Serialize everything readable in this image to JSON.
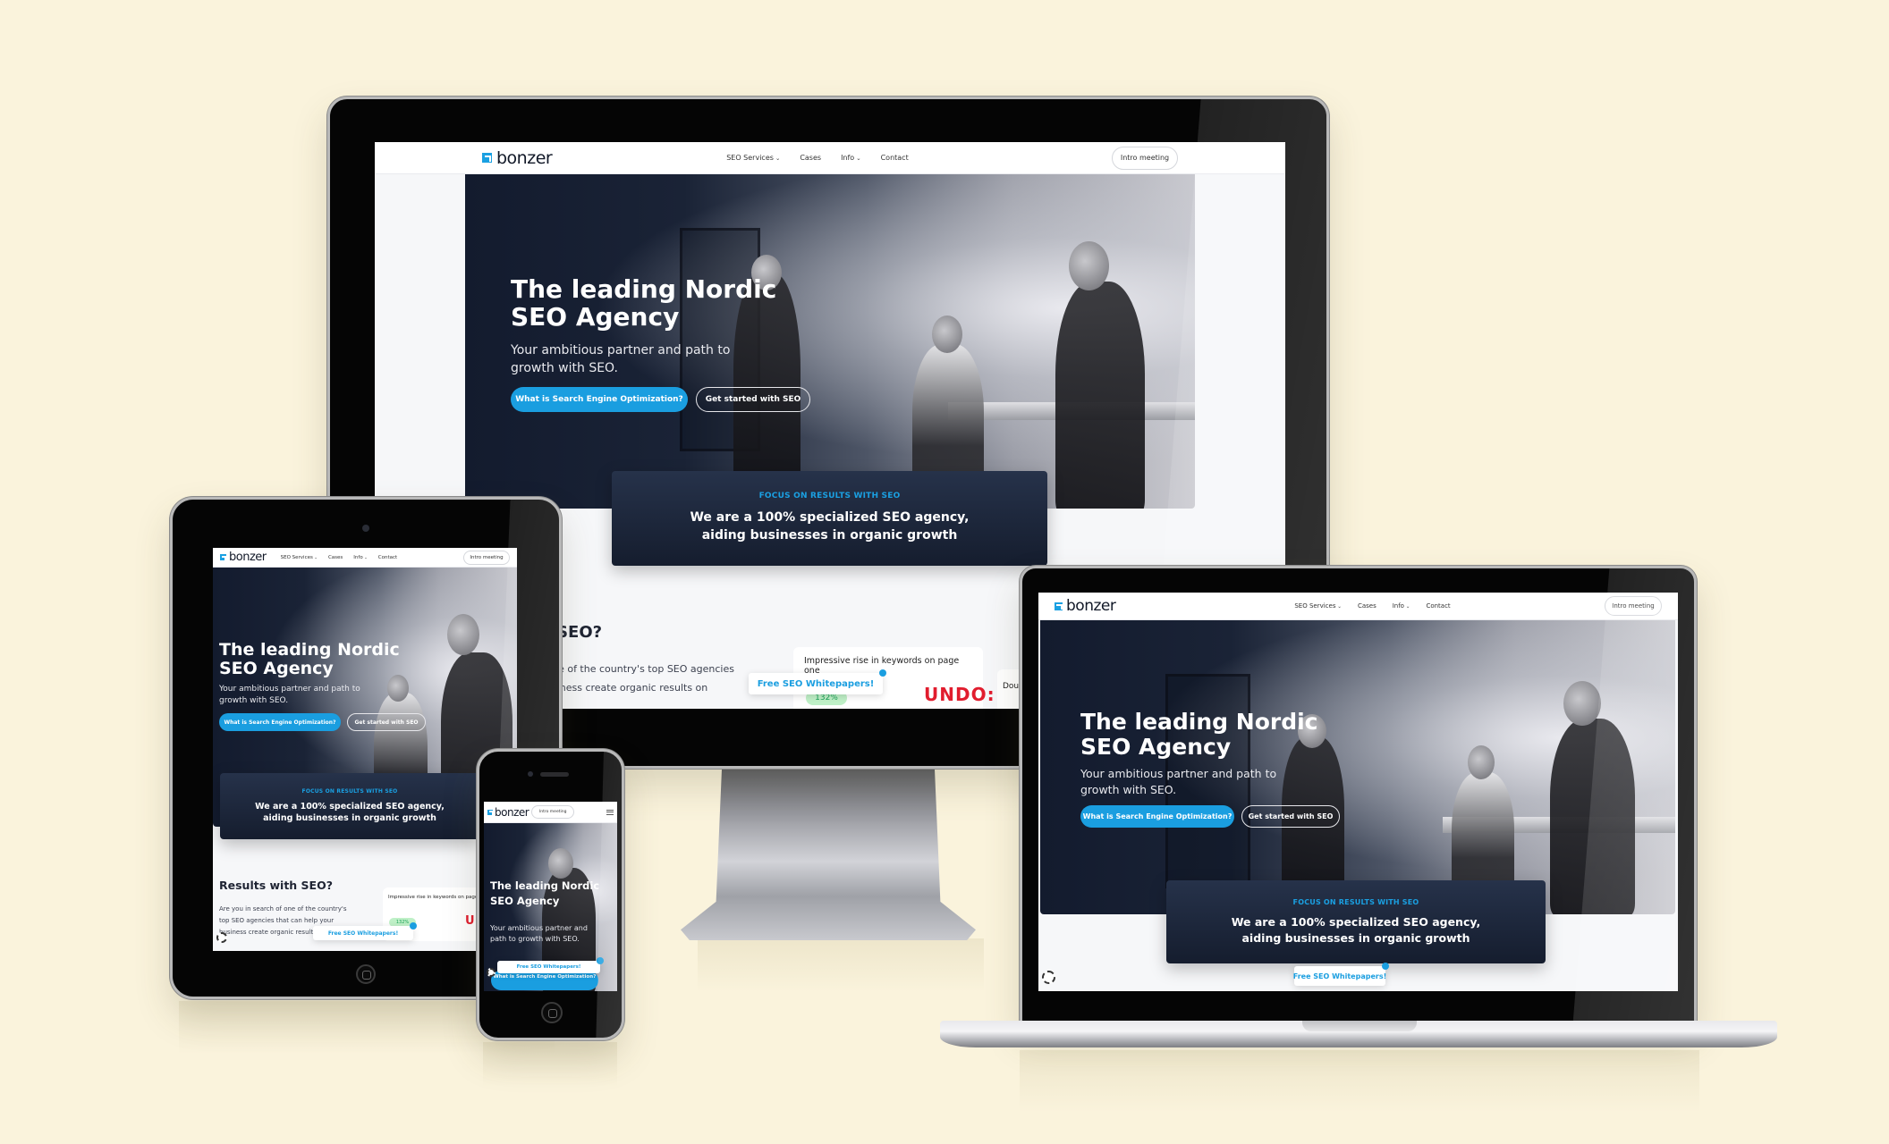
{
  "site": {
    "brand": "bonzer",
    "nav": [
      {
        "label": "SEO Services",
        "has_dropdown": true
      },
      {
        "label": "Cases",
        "has_dropdown": false
      },
      {
        "label": "Info",
        "has_dropdown": true
      },
      {
        "label": "Contact",
        "has_dropdown": false
      }
    ],
    "intro_button": "Intro meeting",
    "hero": {
      "title_line1": "The leading Nordic",
      "title_line2": "SEO Agency",
      "subtitle": "Your ambitious partner and path to growth with SEO.",
      "primary_cta": "What is Search Engine Optimization?",
      "secondary_cta": "Get started with SEO"
    },
    "focus": {
      "eyebrow": "FOCUS ON RESULTS WITH SEO",
      "line1": "We are a 100% specialized SEO agency,",
      "line2": "aiding businesses in organic growth"
    },
    "results": {
      "title": "Results with SEO?",
      "title_cropped": "h SEO?",
      "body_line1": "Are you in search of one of the country's",
      "body_line2": "top SEO agencies that can help your",
      "body_line3": "business create organic results on",
      "body_cropped1": "f one of the country's top SEO agencies",
      "body_cropped2": "business create organic results on",
      "stat_label": "Impressive rise in keywords on page one",
      "stat_value": "132%",
      "brand_logo_text": "UNDO:",
      "next_card_cropped": "Dou"
    },
    "whitepaper_button": "Free SEO Whitepapers!",
    "cookie_icon": "cookie-settings-icon"
  },
  "colors": {
    "background": "#faf3dc",
    "accent": "#1a9ee0",
    "dark_card": "#1c2538",
    "undo_red": "#e11d2e",
    "positive_green": "#1ea35a"
  },
  "devices": [
    "desktop-monitor",
    "tablet",
    "phone",
    "laptop"
  ]
}
